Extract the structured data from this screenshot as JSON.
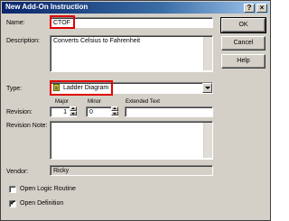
{
  "window": {
    "title": "New Add-On Instruction",
    "help_glyph": "?",
    "close_glyph": "×"
  },
  "form": {
    "name_label": "Name:",
    "name_value": "CTOF",
    "description_label": "Description:",
    "description_value": "Converts Celsius to Fahrenheit",
    "type_label": "Type:",
    "type_value": "Ladder Diagram",
    "type_icon": "ladder-diagram-icon",
    "revision_label": "Revision:",
    "major_label": "Major",
    "major_value": "1",
    "minor_label": "Minor",
    "minor_value": "0",
    "extended_text_label": "Extended Text",
    "extended_text_value": "",
    "revision_note_label": "Revision Note:",
    "revision_note_value": "",
    "vendor_label": "Vendor:",
    "vendor_value": "Ricky",
    "open_logic_label": "Open Logic Routine",
    "open_logic_checked": false,
    "open_definition_label": "Open Definition",
    "open_definition_checked": true
  },
  "buttons": {
    "ok": "OK",
    "cancel": "Cancel",
    "help": "Help"
  },
  "colors": {
    "highlight": "#e00000",
    "titlebar_start": "#0a246a",
    "titlebar_end": "#a6caf0",
    "face": "#d4d0c8"
  }
}
